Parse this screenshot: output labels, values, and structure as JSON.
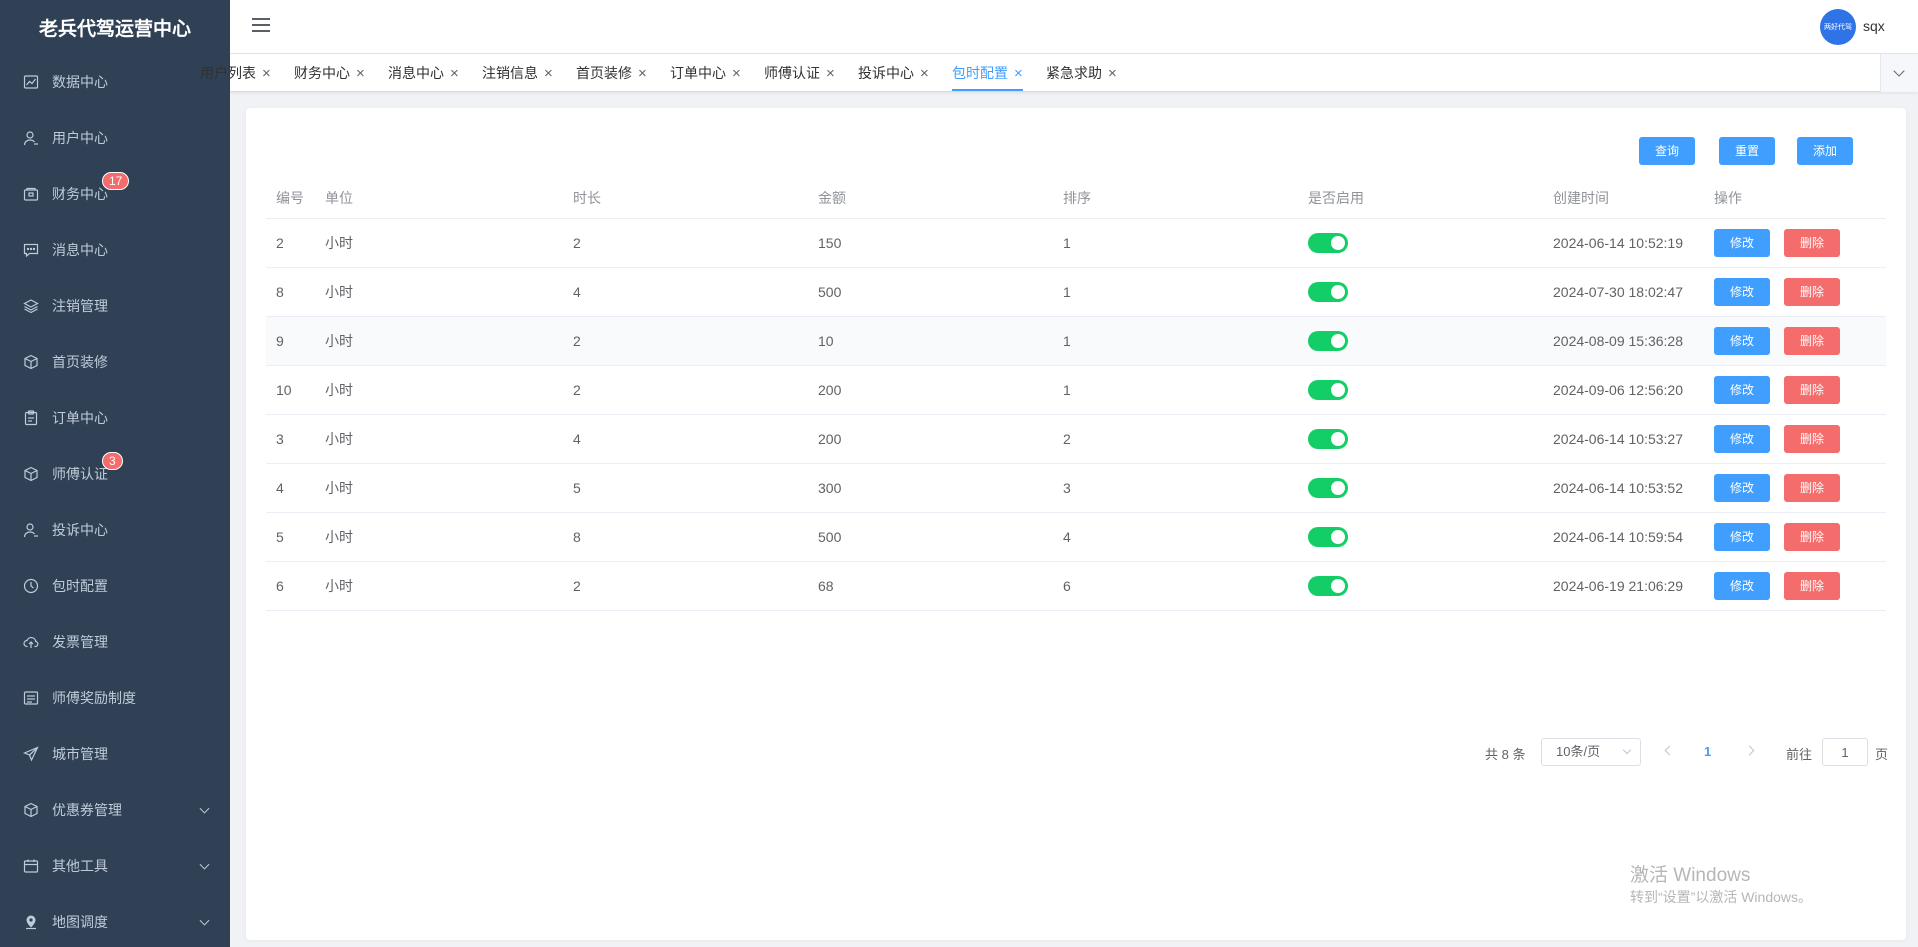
{
  "sidebar": {
    "brand": "老兵代驾运营中心",
    "items": [
      {
        "label": "数据中心",
        "icon": "chart-icon"
      },
      {
        "label": "用户中心",
        "icon": "user-icon"
      },
      {
        "label": "财务中心",
        "icon": "wallet-icon",
        "badge": "17"
      },
      {
        "label": "消息中心",
        "icon": "message-icon"
      },
      {
        "label": "注销管理",
        "icon": "layers-icon"
      },
      {
        "label": "首页装修",
        "icon": "cube-icon"
      },
      {
        "label": "订单中心",
        "icon": "clipboard-icon"
      },
      {
        "label": "师傅认证",
        "icon": "cube-icon",
        "badge": "3"
      },
      {
        "label": "投诉中心",
        "icon": "user-icon"
      },
      {
        "label": "包时配置",
        "icon": "clock-icon"
      },
      {
        "label": "发票管理",
        "icon": "cloud-upload-icon"
      },
      {
        "label": "师傅奖励制度",
        "icon": "list-icon"
      },
      {
        "label": "城市管理",
        "icon": "send-icon"
      },
      {
        "label": "优惠券管理",
        "icon": "cube-icon",
        "expandable": true
      },
      {
        "label": "其他工具",
        "icon": "calendar-icon",
        "expandable": true
      },
      {
        "label": "地图调度",
        "icon": "location-icon",
        "expandable": true
      }
    ]
  },
  "header": {
    "avatar_text": "两好代驾",
    "username": "sqx"
  },
  "tabs": [
    {
      "label": "用户列表"
    },
    {
      "label": "财务中心"
    },
    {
      "label": "消息中心"
    },
    {
      "label": "注销信息"
    },
    {
      "label": "首页装修"
    },
    {
      "label": "订单中心"
    },
    {
      "label": "师傅认证"
    },
    {
      "label": "投诉中心"
    },
    {
      "label": "包时配置",
      "active": true
    },
    {
      "label": "紧急求助"
    }
  ],
  "toolbar": {
    "query_label": "查询",
    "reset_label": "重置",
    "add_label": "添加"
  },
  "table": {
    "columns": [
      "编号",
      "单位",
      "时长",
      "金额",
      "排序",
      "是否启用",
      "创建时间",
      "操作"
    ],
    "rows": [
      {
        "id": "2",
        "unit": "小时",
        "duration": "2",
        "amount": "150",
        "sort": "1",
        "enabled": true,
        "created": "2024-06-14 10:52:19"
      },
      {
        "id": "8",
        "unit": "小时",
        "duration": "4",
        "amount": "500",
        "sort": "1",
        "enabled": true,
        "created": "2024-07-30 18:02:47"
      },
      {
        "id": "9",
        "unit": "小时",
        "duration": "2",
        "amount": "10",
        "sort": "1",
        "enabled": true,
        "created": "2024-08-09 15:36:28"
      },
      {
        "id": "10",
        "unit": "小时",
        "duration": "2",
        "amount": "200",
        "sort": "1",
        "enabled": true,
        "created": "2024-09-06 12:56:20"
      },
      {
        "id": "3",
        "unit": "小时",
        "duration": "4",
        "amount": "200",
        "sort": "2",
        "enabled": true,
        "created": "2024-06-14 10:53:27"
      },
      {
        "id": "4",
        "unit": "小时",
        "duration": "5",
        "amount": "300",
        "sort": "3",
        "enabled": true,
        "created": "2024-06-14 10:53:52"
      },
      {
        "id": "5",
        "unit": "小时",
        "duration": "8",
        "amount": "500",
        "sort": "4",
        "enabled": true,
        "created": "2024-06-14 10:59:54"
      },
      {
        "id": "6",
        "unit": "小时",
        "duration": "2",
        "amount": "68",
        "sort": "6",
        "enabled": true,
        "created": "2024-06-19 21:06:29"
      }
    ],
    "edit_label": "修改",
    "delete_label": "删除"
  },
  "pagination": {
    "total_text": "共 8 条",
    "page_size": "10条/页",
    "current_page": "1",
    "goto_label": "前往",
    "goto_value": "1",
    "page_unit": "页"
  },
  "watermark": {
    "line1": "激活 Windows",
    "line2": "转到“设置”以激活 Windows。"
  }
}
